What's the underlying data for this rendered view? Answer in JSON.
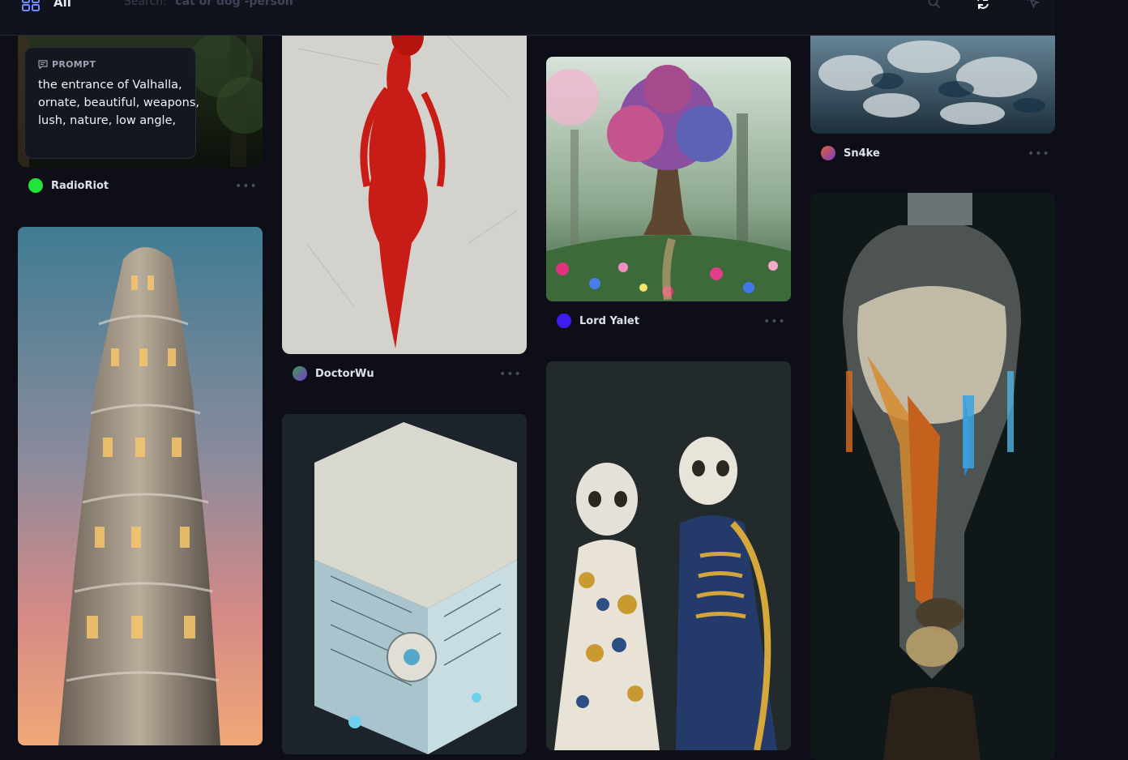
{
  "topbar": {
    "category_label": "All",
    "search_prefix": "Search:",
    "search_placeholder": "cat or dog -person"
  },
  "cards": {
    "radioriot": {
      "author": "RadioRiot",
      "avatar_color": "#22e33a",
      "prompt_heading": "PROMPT",
      "prompt_text": "the entrance of Valhalla, ornate, beautiful, weapons, lush, nature, low angle,"
    },
    "doctorwu": {
      "author": "DoctorWu"
    },
    "lordyalet": {
      "author": "Lord Yalet",
      "avatar_color": "#3d1cf0"
    },
    "sn4ke": {
      "author": "Sn4ke"
    }
  },
  "more_label": "•••"
}
